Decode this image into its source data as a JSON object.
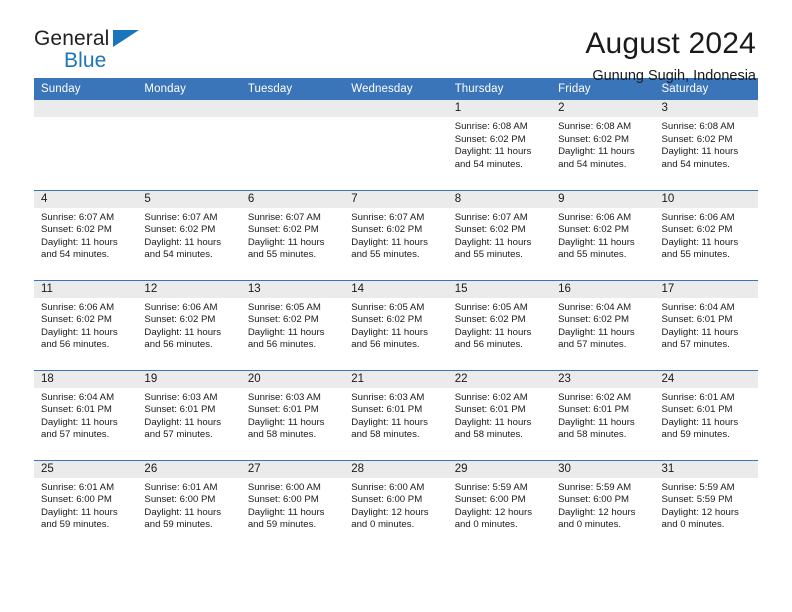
{
  "brand": {
    "name_top": "General",
    "name_bottom": "Blue",
    "triangle_color": "#1b75bc",
    "text_color": "#231f20"
  },
  "header": {
    "title": "August 2024",
    "subtitle": "Gunung Sugih, Indonesia"
  },
  "theme": {
    "header_blue": "#3a75b9",
    "daynum_gray": "#ebebeb",
    "text": "#1a1a1a"
  },
  "weekdays": [
    "Sunday",
    "Monday",
    "Tuesday",
    "Wednesday",
    "Thursday",
    "Friday",
    "Saturday"
  ],
  "weeks": [
    [
      {
        "day": "",
        "blank": true
      },
      {
        "day": "",
        "blank": true
      },
      {
        "day": "",
        "blank": true
      },
      {
        "day": "",
        "blank": true
      },
      {
        "day": "1",
        "sunrise": "Sunrise: 6:08 AM",
        "sunset": "Sunset: 6:02 PM",
        "daylight1": "Daylight: 11 hours",
        "daylight2": "and 54 minutes."
      },
      {
        "day": "2",
        "sunrise": "Sunrise: 6:08 AM",
        "sunset": "Sunset: 6:02 PM",
        "daylight1": "Daylight: 11 hours",
        "daylight2": "and 54 minutes."
      },
      {
        "day": "3",
        "sunrise": "Sunrise: 6:08 AM",
        "sunset": "Sunset: 6:02 PM",
        "daylight1": "Daylight: 11 hours",
        "daylight2": "and 54 minutes."
      }
    ],
    [
      {
        "day": "4",
        "sunrise": "Sunrise: 6:07 AM",
        "sunset": "Sunset: 6:02 PM",
        "daylight1": "Daylight: 11 hours",
        "daylight2": "and 54 minutes."
      },
      {
        "day": "5",
        "sunrise": "Sunrise: 6:07 AM",
        "sunset": "Sunset: 6:02 PM",
        "daylight1": "Daylight: 11 hours",
        "daylight2": "and 54 minutes."
      },
      {
        "day": "6",
        "sunrise": "Sunrise: 6:07 AM",
        "sunset": "Sunset: 6:02 PM",
        "daylight1": "Daylight: 11 hours",
        "daylight2": "and 55 minutes."
      },
      {
        "day": "7",
        "sunrise": "Sunrise: 6:07 AM",
        "sunset": "Sunset: 6:02 PM",
        "daylight1": "Daylight: 11 hours",
        "daylight2": "and 55 minutes."
      },
      {
        "day": "8",
        "sunrise": "Sunrise: 6:07 AM",
        "sunset": "Sunset: 6:02 PM",
        "daylight1": "Daylight: 11 hours",
        "daylight2": "and 55 minutes."
      },
      {
        "day": "9",
        "sunrise": "Sunrise: 6:06 AM",
        "sunset": "Sunset: 6:02 PM",
        "daylight1": "Daylight: 11 hours",
        "daylight2": "and 55 minutes."
      },
      {
        "day": "10",
        "sunrise": "Sunrise: 6:06 AM",
        "sunset": "Sunset: 6:02 PM",
        "daylight1": "Daylight: 11 hours",
        "daylight2": "and 55 minutes."
      }
    ],
    [
      {
        "day": "11",
        "sunrise": "Sunrise: 6:06 AM",
        "sunset": "Sunset: 6:02 PM",
        "daylight1": "Daylight: 11 hours",
        "daylight2": "and 56 minutes."
      },
      {
        "day": "12",
        "sunrise": "Sunrise: 6:06 AM",
        "sunset": "Sunset: 6:02 PM",
        "daylight1": "Daylight: 11 hours",
        "daylight2": "and 56 minutes."
      },
      {
        "day": "13",
        "sunrise": "Sunrise: 6:05 AM",
        "sunset": "Sunset: 6:02 PM",
        "daylight1": "Daylight: 11 hours",
        "daylight2": "and 56 minutes."
      },
      {
        "day": "14",
        "sunrise": "Sunrise: 6:05 AM",
        "sunset": "Sunset: 6:02 PM",
        "daylight1": "Daylight: 11 hours",
        "daylight2": "and 56 minutes."
      },
      {
        "day": "15",
        "sunrise": "Sunrise: 6:05 AM",
        "sunset": "Sunset: 6:02 PM",
        "daylight1": "Daylight: 11 hours",
        "daylight2": "and 56 minutes."
      },
      {
        "day": "16",
        "sunrise": "Sunrise: 6:04 AM",
        "sunset": "Sunset: 6:02 PM",
        "daylight1": "Daylight: 11 hours",
        "daylight2": "and 57 minutes."
      },
      {
        "day": "17",
        "sunrise": "Sunrise: 6:04 AM",
        "sunset": "Sunset: 6:01 PM",
        "daylight1": "Daylight: 11 hours",
        "daylight2": "and 57 minutes."
      }
    ],
    [
      {
        "day": "18",
        "sunrise": "Sunrise: 6:04 AM",
        "sunset": "Sunset: 6:01 PM",
        "daylight1": "Daylight: 11 hours",
        "daylight2": "and 57 minutes."
      },
      {
        "day": "19",
        "sunrise": "Sunrise: 6:03 AM",
        "sunset": "Sunset: 6:01 PM",
        "daylight1": "Daylight: 11 hours",
        "daylight2": "and 57 minutes."
      },
      {
        "day": "20",
        "sunrise": "Sunrise: 6:03 AM",
        "sunset": "Sunset: 6:01 PM",
        "daylight1": "Daylight: 11 hours",
        "daylight2": "and 58 minutes."
      },
      {
        "day": "21",
        "sunrise": "Sunrise: 6:03 AM",
        "sunset": "Sunset: 6:01 PM",
        "daylight1": "Daylight: 11 hours",
        "daylight2": "and 58 minutes."
      },
      {
        "day": "22",
        "sunrise": "Sunrise: 6:02 AM",
        "sunset": "Sunset: 6:01 PM",
        "daylight1": "Daylight: 11 hours",
        "daylight2": "and 58 minutes."
      },
      {
        "day": "23",
        "sunrise": "Sunrise: 6:02 AM",
        "sunset": "Sunset: 6:01 PM",
        "daylight1": "Daylight: 11 hours",
        "daylight2": "and 58 minutes."
      },
      {
        "day": "24",
        "sunrise": "Sunrise: 6:01 AM",
        "sunset": "Sunset: 6:01 PM",
        "daylight1": "Daylight: 11 hours",
        "daylight2": "and 59 minutes."
      }
    ],
    [
      {
        "day": "25",
        "sunrise": "Sunrise: 6:01 AM",
        "sunset": "Sunset: 6:00 PM",
        "daylight1": "Daylight: 11 hours",
        "daylight2": "and 59 minutes."
      },
      {
        "day": "26",
        "sunrise": "Sunrise: 6:01 AM",
        "sunset": "Sunset: 6:00 PM",
        "daylight1": "Daylight: 11 hours",
        "daylight2": "and 59 minutes."
      },
      {
        "day": "27",
        "sunrise": "Sunrise: 6:00 AM",
        "sunset": "Sunset: 6:00 PM",
        "daylight1": "Daylight: 11 hours",
        "daylight2": "and 59 minutes."
      },
      {
        "day": "28",
        "sunrise": "Sunrise: 6:00 AM",
        "sunset": "Sunset: 6:00 PM",
        "daylight1": "Daylight: 12 hours",
        "daylight2": "and 0 minutes."
      },
      {
        "day": "29",
        "sunrise": "Sunrise: 5:59 AM",
        "sunset": "Sunset: 6:00 PM",
        "daylight1": "Daylight: 12 hours",
        "daylight2": "and 0 minutes."
      },
      {
        "day": "30",
        "sunrise": "Sunrise: 5:59 AM",
        "sunset": "Sunset: 6:00 PM",
        "daylight1": "Daylight: 12 hours",
        "daylight2": "and 0 minutes."
      },
      {
        "day": "31",
        "sunrise": "Sunrise: 5:59 AM",
        "sunset": "Sunset: 5:59 PM",
        "daylight1": "Daylight: 12 hours",
        "daylight2": "and 0 minutes."
      }
    ]
  ]
}
